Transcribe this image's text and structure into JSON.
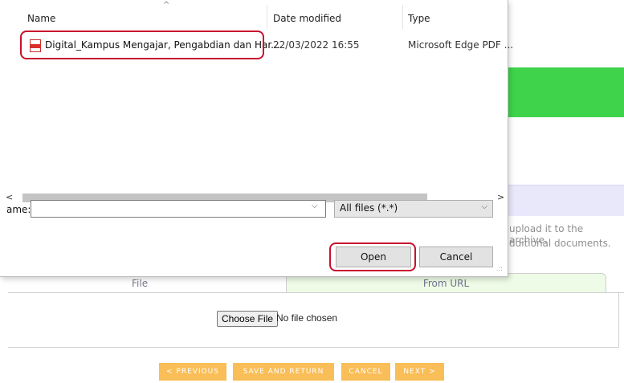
{
  "dialog": {
    "columns": {
      "name": "Name",
      "date_modified": "Date modified",
      "type": "Type"
    },
    "sort_caret": "^",
    "file": {
      "name": "Digital_Kampus Mengajar, Pengabdian dan Har...",
      "date": "22/03/2022 16:55",
      "type": "Microsoft Edge PDF ..."
    },
    "scroll_left": "<",
    "scroll_right": ">",
    "filename_label": "ame:",
    "filename_value": "",
    "dropdown_arrow": "⌵",
    "filter": "All files (*.*)",
    "open_label": "Open",
    "cancel_label": "Cancel",
    "grip": ".::"
  },
  "page": {
    "side_text_1": "upload it to the archive.",
    "side_text_2": "dditional documents.",
    "tab_file": "File",
    "tab_url": "From URL",
    "choose_file": "Choose File",
    "no_file": "No file chosen",
    "buttons": {
      "previous": "< PREVIOUS",
      "save_return": "SAVE AND RETURN",
      "cancel": "CANCEL",
      "next": "NEXT >"
    }
  },
  "colors": {
    "accent_green": "#3fd34c",
    "button_orange": "#f9be57",
    "highlight_red": "#c8102e"
  }
}
